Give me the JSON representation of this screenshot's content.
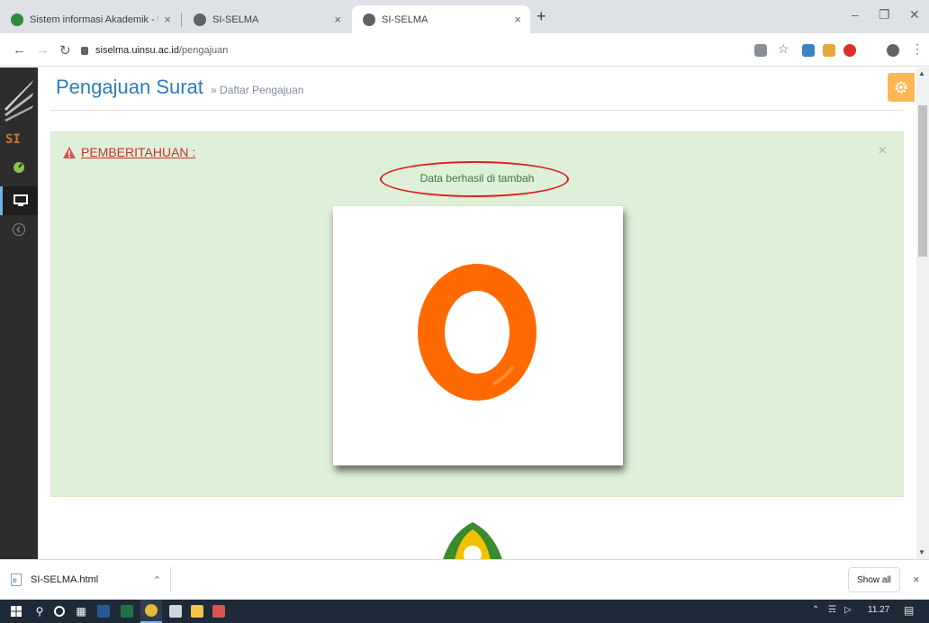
{
  "browser": {
    "tabs": [
      {
        "title": "Sistem informasi Akademik - Uni",
        "active": false
      },
      {
        "title": "SI-SELMA",
        "active": false
      },
      {
        "title": "SI-SELMA",
        "active": true
      }
    ],
    "new_tab": "+",
    "close": "×",
    "url_domain": "siselma.uinsu.ac.id",
    "url_path": "/pengajuan"
  },
  "page": {
    "title": "Pengajuan Surat",
    "breadcrumb": "» Daftar Pengajuan",
    "logo_text": "SI",
    "alert": {
      "title": "PEMBERITAHUAN :",
      "message": "Data berhasil di tambah",
      "close": "×"
    }
  },
  "downloads": {
    "file": "SI-SELMA.html",
    "show_all": "Show all",
    "close": "×"
  },
  "taskbar": {
    "time": "11.27"
  },
  "colors": {
    "accent": "#2b7dbc",
    "alert_bg": "#dff0d8",
    "loader_ring": "#ff6a00",
    "settings_button": "#ffb752",
    "annotation": "#e01d1d"
  }
}
